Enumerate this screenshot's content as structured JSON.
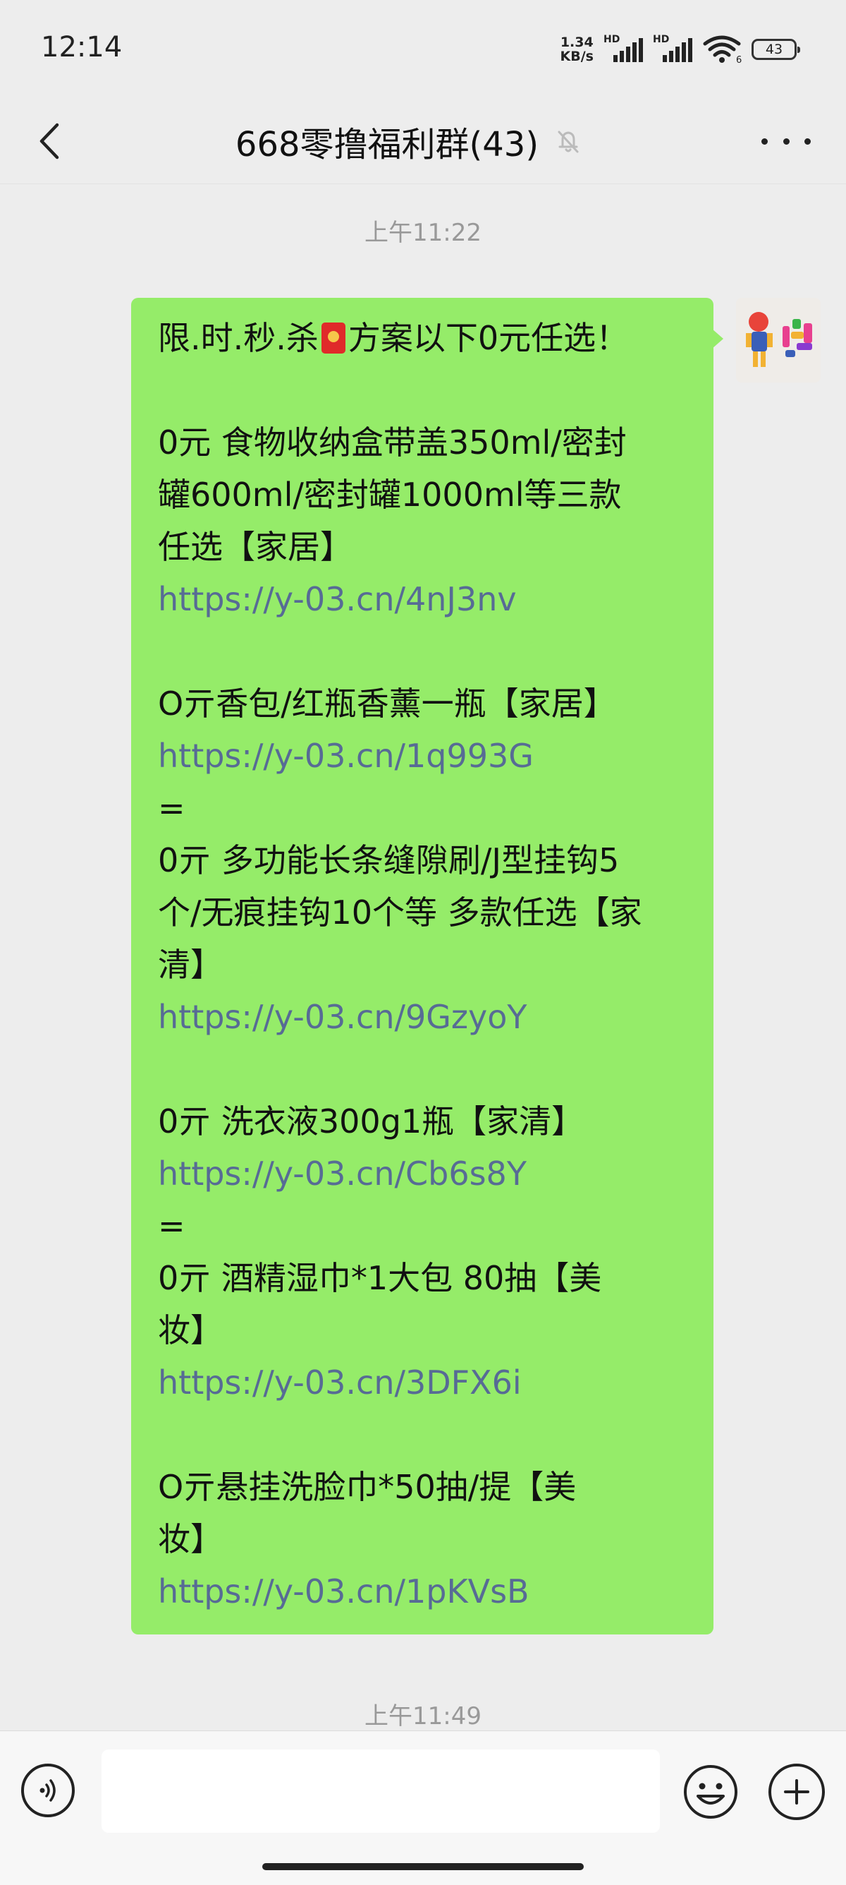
{
  "status_bar": {
    "time": "12:14",
    "net_speed_value": "1.34",
    "net_speed_unit": "KB/s",
    "sim1_label": "HD",
    "sim2_label": "HD",
    "wifi_badge": "6",
    "battery": "43"
  },
  "nav": {
    "title": "668零撸福利群(43)"
  },
  "timestamps": {
    "first": "上午11:22",
    "second": "上午11:49"
  },
  "message": {
    "lines": [
      {
        "text": "限.时.秒.杀",
        "after": "方案以下0元任选！",
        "type": "redpacket"
      },
      {
        "text": "",
        "type": "blank"
      },
      {
        "text": "0元 食物收纳盒带盖350ml/密封",
        "type": "text"
      },
      {
        "text": "罐600ml/密封罐1000ml等三款",
        "type": "text"
      },
      {
        "text": "任选【家居】",
        "type": "text"
      },
      {
        "text": "https://y-03.cn/4nJ3nv",
        "type": "link"
      },
      {
        "text": "",
        "type": "blank"
      },
      {
        "text": "O亓香包/红瓶香薰一瓶【家居】",
        "type": "text"
      },
      {
        "text": "https://y-03.cn/1q993G",
        "type": "link"
      },
      {
        "text": "=",
        "type": "text"
      },
      {
        "text": "0亓 多功能长条缝隙刷/J型挂钩5",
        "type": "text"
      },
      {
        "text": "个/无痕挂钩10个等 多款任选【家",
        "type": "text"
      },
      {
        "text": "清】",
        "type": "text"
      },
      {
        "text": "https://y-03.cn/9GzyoY",
        "type": "link"
      },
      {
        "text": "",
        "type": "blank"
      },
      {
        "text": "0亓 洗衣液300g1瓶【家清】",
        "type": "text"
      },
      {
        "text": "https://y-03.cn/Cb6s8Y",
        "type": "link"
      },
      {
        "text": "=",
        "type": "text"
      },
      {
        "text": "0亓 酒精湿巾*1大包 80抽【美",
        "type": "text"
      },
      {
        "text": "妆】",
        "type": "text"
      },
      {
        "text": "https://y-03.cn/3DFX6i",
        "type": "link"
      },
      {
        "text": "",
        "type": "blank"
      },
      {
        "text": "O亓悬挂洗脸巾*50抽/提【美",
        "type": "text"
      },
      {
        "text": "妆】",
        "type": "text"
      },
      {
        "text": "https://y-03.cn/1pKVsB",
        "type": "link"
      }
    ]
  },
  "icons": {
    "back": "chevron-left-icon",
    "mute": "bell-off-icon",
    "more": "more-dots-icon",
    "voice": "voice-icon",
    "emoji": "smile-icon",
    "plus": "plus-icon"
  },
  "colors": {
    "background": "#ededed",
    "bubble": "#95ec69",
    "link": "#576b95",
    "timestamp": "#999999"
  }
}
